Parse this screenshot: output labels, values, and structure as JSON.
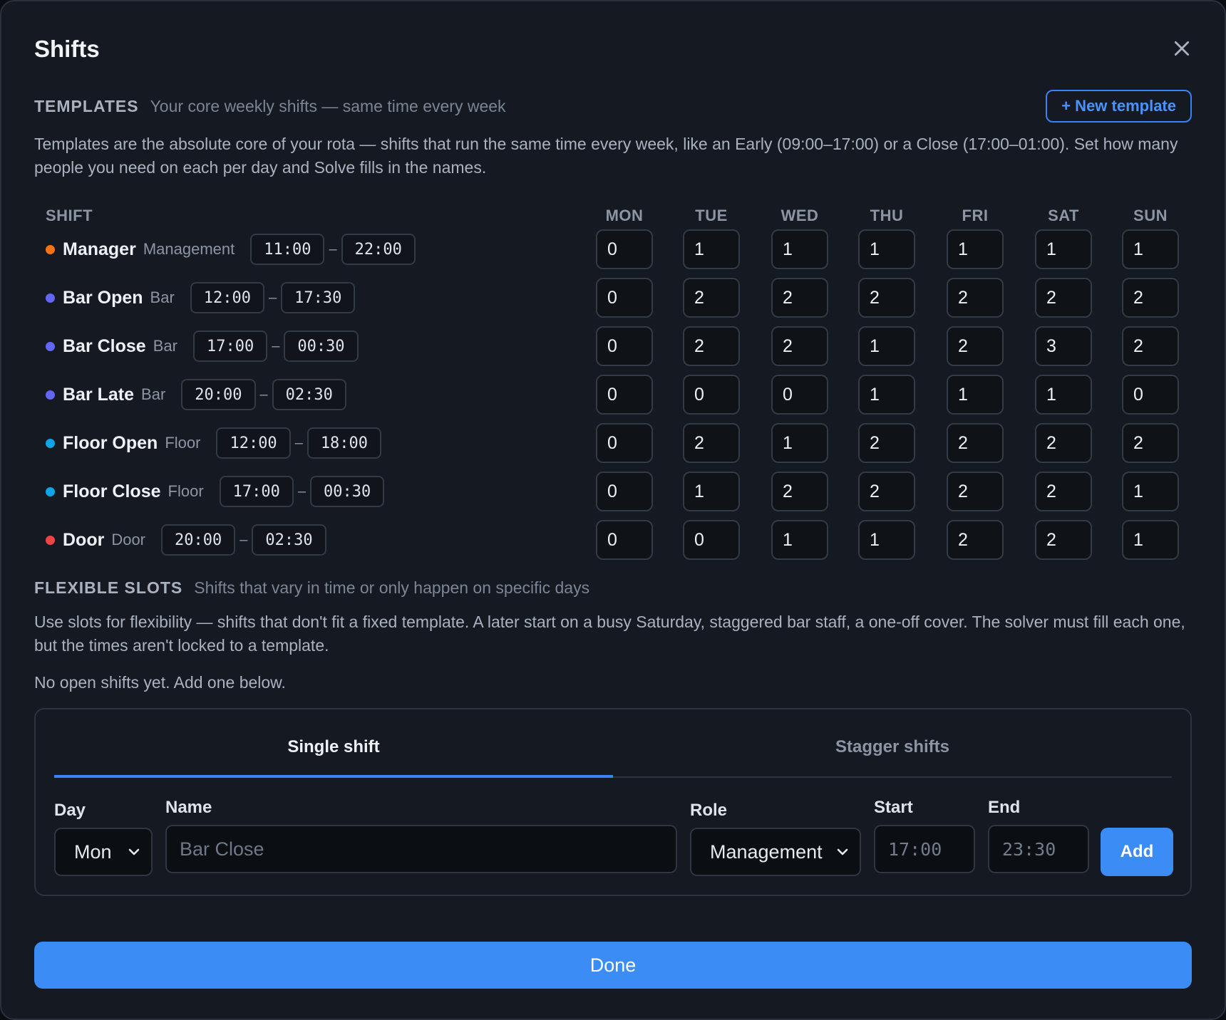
{
  "modal": {
    "title": "Shifts"
  },
  "templates": {
    "label": "TEMPLATES",
    "subtitle": "Your core weekly shifts — same time every week",
    "new_button": "+ New template",
    "description": "Templates are the absolute core of your rota — shifts that run the same time every week, like an Early (09:00–17:00) or a Close (17:00–01:00). Set how many people you need on each per day and Solve fills in the names.",
    "shift_header": "SHIFT",
    "days": [
      "MON",
      "TUE",
      "WED",
      "THU",
      "FRI",
      "SAT",
      "SUN"
    ],
    "rows": [
      {
        "name": "Manager",
        "role": "Management",
        "start": "11:00",
        "end": "22:00",
        "color": "#f97316",
        "counts": [
          "0",
          "1",
          "1",
          "1",
          "1",
          "1",
          "1"
        ]
      },
      {
        "name": "Bar Open",
        "role": "Bar",
        "start": "12:00",
        "end": "17:30",
        "color": "#6366f1",
        "counts": [
          "0",
          "2",
          "2",
          "2",
          "2",
          "2",
          "2"
        ]
      },
      {
        "name": "Bar Close",
        "role": "Bar",
        "start": "17:00",
        "end": "00:30",
        "color": "#6366f1",
        "counts": [
          "0",
          "2",
          "2",
          "1",
          "2",
          "3",
          "2"
        ]
      },
      {
        "name": "Bar Late",
        "role": "Bar",
        "start": "20:00",
        "end": "02:30",
        "color": "#6366f1",
        "counts": [
          "0",
          "0",
          "0",
          "1",
          "1",
          "1",
          "0"
        ]
      },
      {
        "name": "Floor Open",
        "role": "Floor",
        "start": "12:00",
        "end": "18:00",
        "color": "#0ea5e9",
        "counts": [
          "0",
          "2",
          "1",
          "2",
          "2",
          "2",
          "2"
        ]
      },
      {
        "name": "Floor Close",
        "role": "Floor",
        "start": "17:00",
        "end": "00:30",
        "color": "#0ea5e9",
        "counts": [
          "0",
          "1",
          "2",
          "2",
          "2",
          "2",
          "1"
        ]
      },
      {
        "name": "Door",
        "role": "Door",
        "start": "20:00",
        "end": "02:30",
        "color": "#ef4444",
        "counts": [
          "0",
          "0",
          "1",
          "1",
          "2",
          "2",
          "1"
        ]
      }
    ]
  },
  "flexible": {
    "label": "FLEXIBLE SLOTS",
    "subtitle": "Shifts that vary in time or only happen on specific days",
    "description": "Use slots for flexibility — shifts that don't fit a fixed template. A later start on a busy Saturday, staggered bar staff, a one-off cover. The solver must fill each one, but the times aren't locked to a template.",
    "empty_note": "No open shifts yet. Add one below."
  },
  "form": {
    "tabs": [
      "Single shift",
      "Stagger shifts"
    ],
    "day_label": "Day",
    "day_value": "Mon",
    "name_label": "Name",
    "name_placeholder": "Bar Close",
    "role_label": "Role",
    "role_value": "Management",
    "start_label": "Start",
    "start_placeholder": "17:00",
    "end_label": "End",
    "end_placeholder": "23:30",
    "add_button": "Add"
  },
  "done_button": "Done"
}
